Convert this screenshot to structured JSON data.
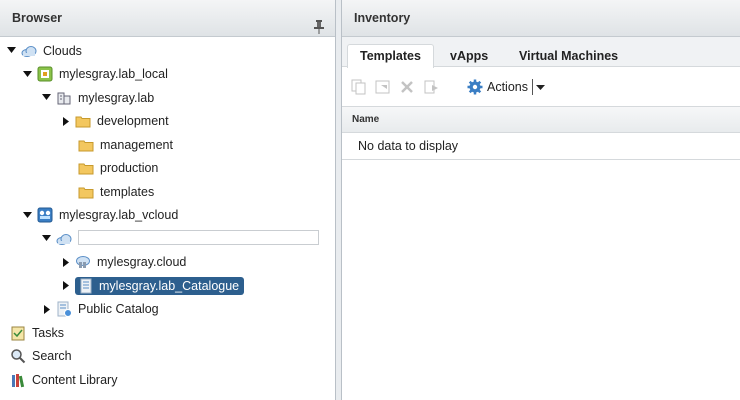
{
  "browser": {
    "title": "Browser",
    "tree": {
      "clouds": "Clouds",
      "lab_local": "mylesgray.lab_local",
      "lab_domain": "mylesgray.lab",
      "development": "development",
      "management": "management",
      "production": "production",
      "templates": "templates",
      "lab_vcloud": "mylesgray.lab_vcloud",
      "org_name_value": "",
      "cloud": "mylesgray.cloud",
      "catalogue": "mylesgray.lab_Catalogue",
      "public_catalog": "Public Catalog"
    },
    "bottom": {
      "tasks": "Tasks",
      "search": "Search",
      "content_library": "Content Library"
    }
  },
  "inventory": {
    "title": "Inventory",
    "tabs": [
      "Templates",
      "vApps",
      "Virtual Machines"
    ],
    "active_tab": "Templates",
    "actions_label": "Actions",
    "grid": {
      "column_name": "Name",
      "empty_text": "No data to display"
    }
  },
  "colors": {
    "selection": "#2d5f8e",
    "folder": "#f3c75f",
    "cloud": "#5b8fc7"
  }
}
